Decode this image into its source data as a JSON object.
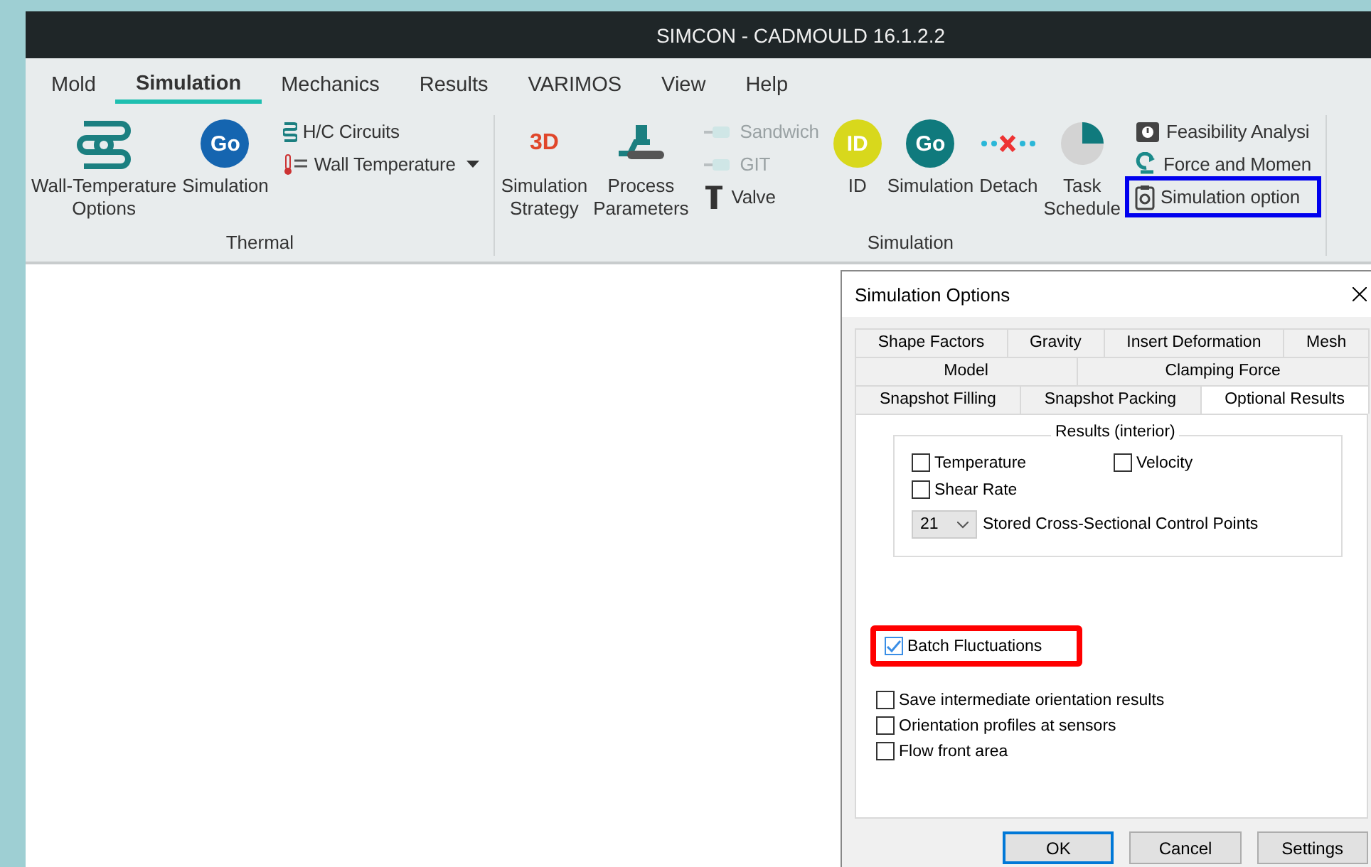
{
  "window": {
    "title": "SIMCON - CADMOULD 16.1.2.2"
  },
  "menu_tabs": [
    {
      "label": "Mold",
      "selected": false
    },
    {
      "label": "Simulation",
      "selected": true
    },
    {
      "label": "Mechanics",
      "selected": false
    },
    {
      "label": "Results",
      "selected": false
    },
    {
      "label": "VARIMOS",
      "selected": false
    },
    {
      "label": "View",
      "selected": false
    },
    {
      "label": "Help",
      "selected": false
    }
  ],
  "ribbon": [
    {
      "label": "Thermal",
      "items": [
        {
          "kind": "large",
          "label": "Wall-Temperature\nOptions"
        },
        {
          "kind": "large",
          "label": "Simulation",
          "badge": "Go"
        },
        {
          "kind": "stack",
          "items": [
            {
              "label": "H/C Circuits",
              "disabled": false
            },
            {
              "label": "Wall Temperature",
              "disabled": false,
              "dropdown": true
            }
          ]
        }
      ]
    },
    {
      "label": "Simulation",
      "items": [
        {
          "kind": "large",
          "label": "Simulation\nStrategy",
          "badge": "3D"
        },
        {
          "kind": "large",
          "label": "Process\nParameters"
        },
        {
          "kind": "stack",
          "items": [
            {
              "label": "Sandwich",
              "disabled": true
            },
            {
              "label": "GIT",
              "disabled": true
            },
            {
              "label": "Valve",
              "disabled": false
            }
          ]
        },
        {
          "kind": "large",
          "label": "ID",
          "badge": "ID"
        },
        {
          "kind": "large",
          "label": "Simulation",
          "badge": "Go"
        },
        {
          "kind": "large",
          "label": "Detach"
        },
        {
          "kind": "large",
          "label": "Task\nSchedule"
        },
        {
          "kind": "stack",
          "items": [
            {
              "label": "Feasibility Analysi",
              "disabled": false
            },
            {
              "label": "Force and Momen",
              "disabled": false
            },
            {
              "label": "Simulation option",
              "disabled": false,
              "highlighted": true
            }
          ]
        }
      ]
    }
  ],
  "dialog": {
    "title": "Simulation Options",
    "tab_rows": [
      [
        {
          "label": "Shape Factors",
          "selected": false
        },
        {
          "label": "Gravity",
          "selected": false
        },
        {
          "label": "Insert Deformation",
          "selected": false
        },
        {
          "label": "Mesh",
          "selected": false
        }
      ],
      [
        {
          "label": "Model",
          "selected": false
        },
        {
          "label": "Clamping Force",
          "selected": false
        }
      ],
      [
        {
          "label": "Snapshot Filling",
          "selected": false
        },
        {
          "label": "Snapshot Packing",
          "selected": false
        },
        {
          "label": "Optional Results",
          "selected": true
        }
      ]
    ],
    "group": {
      "title": "Results (interior)",
      "checkboxes": [
        {
          "label": "Temperature",
          "checked": false
        },
        {
          "label": "Velocity",
          "checked": false
        },
        {
          "label": "Shear Rate",
          "checked": false
        }
      ],
      "select": {
        "value": "21",
        "label": "Stored Cross-Sectional Control Points"
      }
    },
    "options": [
      {
        "label": "Batch Fluctuations",
        "checked": true,
        "highlighted": true
      },
      {
        "label": "Save intermediate orientation results",
        "checked": false,
        "highlighted": false
      },
      {
        "label": "Orientation profiles at sensors",
        "checked": false,
        "highlighted": false
      },
      {
        "label": "Flow front area",
        "checked": false,
        "highlighted": false
      }
    ],
    "buttons": [
      {
        "label": "OK",
        "default": true
      },
      {
        "label": "Cancel",
        "default": false
      },
      {
        "label": "Settings",
        "default": false
      }
    ]
  }
}
